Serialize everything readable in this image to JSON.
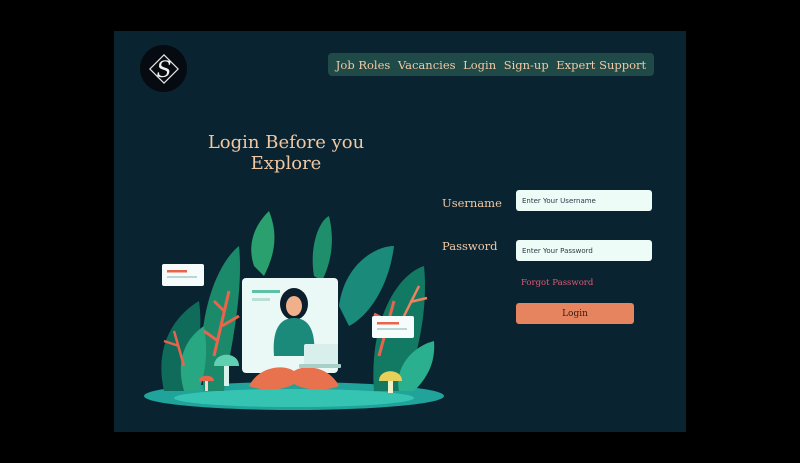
{
  "nav": {
    "items": [
      "Job Roles",
      "Vacancies",
      "Login",
      "Sign-up",
      "Expert Support"
    ]
  },
  "hero": {
    "title_line1": "Login Before you",
    "title_line2": "Explore"
  },
  "form": {
    "username_label": "Username",
    "username_placeholder": "Enter Your Username",
    "password_label": "Password",
    "password_placeholder": "Enter Your Password",
    "forgot_label": "Forgot Password",
    "login_label": "Login"
  },
  "colors": {
    "background": "#0a2330",
    "nav_bg": "#1f4a47",
    "accent_text": "#f0c8a3",
    "button": "#e5845f",
    "link": "#e05a72"
  },
  "icons": {
    "logo": "ornate-s-monogram"
  }
}
